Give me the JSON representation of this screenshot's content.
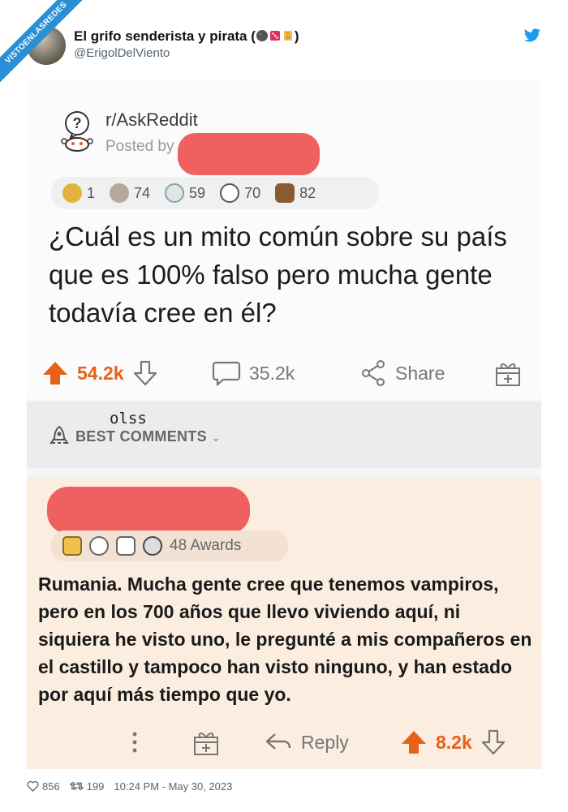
{
  "watermark": "VISTOENLASREDES",
  "tweet": {
    "display_name": "El grifo senderista y pirata (",
    "display_name_end": ")",
    "handle": "@ErigolDelViento",
    "likes": "856",
    "retweets": "199",
    "timestamp": "10:24 PM - May 30, 2023",
    "accent_color": "#1d9bf0"
  },
  "post": {
    "subreddit": "r/AskReddit",
    "posted_by": "Posted by",
    "awards": [
      {
        "icon": "sun-award-icon",
        "count": "1",
        "color": "#e2b33a"
      },
      {
        "icon": "brain-award-icon",
        "count": "74",
        "color": "#b8a89a"
      },
      {
        "icon": "laugh-award-icon",
        "count": "59",
        "color": "#8aa0a8"
      },
      {
        "icon": "silver-award-icon",
        "count": "70",
        "color": "#9aa3a8"
      },
      {
        "icon": "bear-award-icon",
        "count": "82",
        "color": "#8a5a32"
      }
    ],
    "title": "¿Cuál es un mito común sobre su país que es 100% falso pero mucha gente todavía cree en él?",
    "upvotes": "54.2k",
    "comments": "35.2k",
    "share_label": "Share",
    "upvote_color": "#e8601a"
  },
  "best_comments": {
    "handwritten": "olss",
    "label": "BEST COMMENTS"
  },
  "comment": {
    "awards_label": "48 Awards",
    "text": "Rumania. Mucha gente cree que tenemos vampiros, pero en los 700 años que llevo viviendo aquí, ni siquiera he visto uno, le pregunté a mis compañeros en el castillo y tampoco han visto ninguno, y han estado por aquí más tiempo que yo.",
    "reply_label": "Reply",
    "upvotes": "8.2k"
  }
}
